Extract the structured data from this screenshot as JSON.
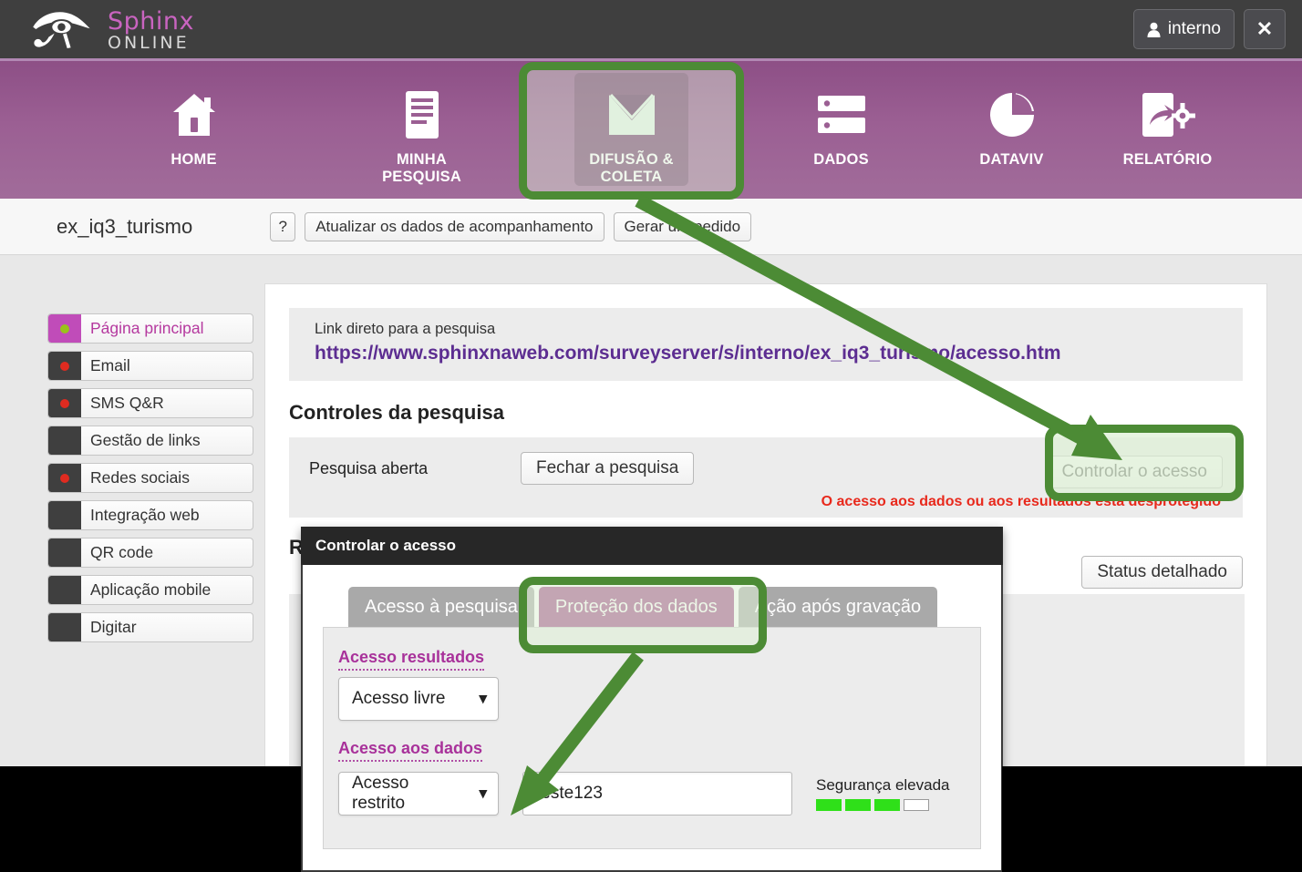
{
  "app": {
    "logo_name": "Sphinx",
    "logo_sub": "ONLINE",
    "user_label": "interno",
    "close_label": "✕"
  },
  "nav": {
    "items": [
      {
        "id": "home",
        "label": "HOME",
        "icon": "house-icon",
        "active": false
      },
      {
        "id": "pesquisa",
        "label": "MINHA PESQUISA",
        "icon": "document-icon",
        "active": false
      },
      {
        "id": "difusao",
        "label": "DIFUSÃO & COLETA",
        "icon": "envelope-icon",
        "active": true
      },
      {
        "id": "dados",
        "label": "DADOS",
        "icon": "database-icon",
        "active": false
      },
      {
        "id": "dataviv",
        "label": "DATAVIV",
        "icon": "pie-chart-icon",
        "active": false
      },
      {
        "id": "relatorio",
        "label": "RELATÓRIO",
        "icon": "report-gear-icon",
        "active": false
      }
    ]
  },
  "toolbar": {
    "survey_name": "ex_iq3_turismo",
    "help_label": "?",
    "update_label": "Atualizar os dados de acompanhamento",
    "order_label": "Gerar um pedido"
  },
  "sidebar": {
    "items": [
      {
        "label": "Página principal",
        "swatch": "magenta",
        "dot": "green",
        "selected": true
      },
      {
        "label": "Email",
        "swatch": "dark",
        "dot": "red",
        "selected": false
      },
      {
        "label": "SMS Q&R",
        "swatch": "dark",
        "dot": "red",
        "selected": false
      },
      {
        "label": "Gestão de links",
        "swatch": "dark",
        "dot": "none",
        "selected": false
      },
      {
        "label": "Redes sociais",
        "swatch": "dark",
        "dot": "red",
        "selected": false
      },
      {
        "label": "Integração web",
        "swatch": "dark",
        "dot": "none",
        "selected": false
      },
      {
        "label": "QR code",
        "swatch": "dark",
        "dot": "none",
        "selected": false
      },
      {
        "label": "Aplicação mobile",
        "swatch": "dark",
        "dot": "none",
        "selected": false
      },
      {
        "label": "Digitar",
        "swatch": "dark",
        "dot": "none",
        "selected": false
      }
    ]
  },
  "content": {
    "link_caption": "Link direto para a pesquisa",
    "link_url": "https://www.sphinxnaweb.com/surveyserver/s/interno/ex_iq3_turismo/acesso.htm",
    "controls_title": "Controles da pesquisa",
    "survey_state_label": "Pesquisa aberta",
    "close_survey_label": "Fechar a pesquisa",
    "control_access_label": "Controlar o acesso",
    "warning": "O acesso aos dados ou aos resultados está desprotegido",
    "results_title": "R",
    "status_label": "Status detalhado"
  },
  "modal": {
    "title": "Controlar o acesso",
    "tabs": [
      {
        "label": "Acesso à pesquisa",
        "active": false
      },
      {
        "label": "Proteção dos dados",
        "active": true
      },
      {
        "label": "Ação após gravação",
        "active": false
      }
    ],
    "results_access_label": "Acesso resultados",
    "results_access_value": "Acesso livre",
    "data_access_label": "Acesso aos dados",
    "data_access_value": "Acesso restrito",
    "password_value": "teste123",
    "strength_label": "Segurança elevada",
    "strength_filled": 3,
    "strength_total": 4
  },
  "colors": {
    "brand_purple": "#8d4f86",
    "brand_magenta": "#c964c0",
    "annotation_green": "#4c8b35",
    "warning_red": "#e8291c",
    "link_purple": "#5c2d91",
    "strength_green": "#2fe019"
  }
}
